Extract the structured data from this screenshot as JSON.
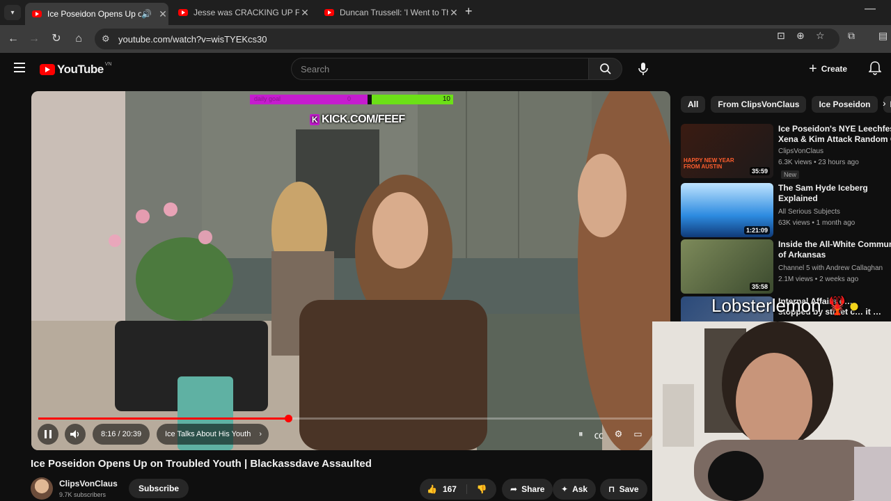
{
  "browser": {
    "tabs": [
      {
        "title": "Ice Poseidon Opens Up on",
        "active": true,
        "audio": true
      },
      {
        "title": "Jesse was CRACKING UP For RA",
        "active": false
      },
      {
        "title": "Duncan Trussell: 'I Went to The",
        "active": false
      }
    ],
    "new_tab": "+",
    "url": "youtube.com/watch?v=wisTYEKcs30"
  },
  "youtube": {
    "logo_text": "YouTube",
    "logo_region": "VN",
    "search_placeholder": "Search",
    "create_label": "Create"
  },
  "player": {
    "time_current": "8:16",
    "time_total": "20:39",
    "time_display": "8:16 / 20:39",
    "progress_fraction": 0.4,
    "chapter": "Ice Talks About His Youth",
    "overlay": {
      "hud_left": "daily goal",
      "hud_mid": "0",
      "hud_right": "10",
      "kick_text": "KICK.COM/FEEF"
    }
  },
  "video": {
    "title": "Ice Poseidon Opens Up on Troubled Youth | Blackassdave Assaulted",
    "channel": "ClipsVonClaus",
    "subscribers": "9.7K subscribers",
    "subscribe_label": "Subscribe",
    "likes": "167",
    "share_label": "Share",
    "ask_label": "Ask",
    "save_label": "Save"
  },
  "sidebar": {
    "chips": [
      "All",
      "From ClipsVonClaus",
      "Ice Poseidon",
      "Re"
    ],
    "related": [
      {
        "title1": "Ice Poseidon's NYE Leechfest:",
        "title2": "Xena & Kim Attack Random Girl",
        "channel": "ClipsVonClaus",
        "meta": "6.3K views • 23 hours ago",
        "badge": "New",
        "duration": "35:59",
        "thumb_text": "HAPPY NEW YEAR FROM AUSTIN"
      },
      {
        "title1": "The Sam Hyde Iceberg",
        "title2": "Explained",
        "channel": "All Serious Subjects",
        "meta": "63K views • 1 month ago",
        "duration": "1:21:09"
      },
      {
        "title1": "Inside the All-White Community",
        "title2": "of Arkansas",
        "channel": "Channel 5 with Andrew Callaghan",
        "meta": "2.1M views • 2 weeks ago",
        "duration": "35:58"
      },
      {
        "title1": "Internal Affairs d…",
        "title2": "stopped by street c… it …",
        "channel": "",
        "meta": ""
      }
    ]
  },
  "stream_overlay": {
    "username": "Lobsterlemon"
  },
  "colors": {
    "yt_red": "#ff0000",
    "bg": "#0f0f0f",
    "kick_purple": "#c51ccf",
    "kick_green": "#6ce017"
  }
}
